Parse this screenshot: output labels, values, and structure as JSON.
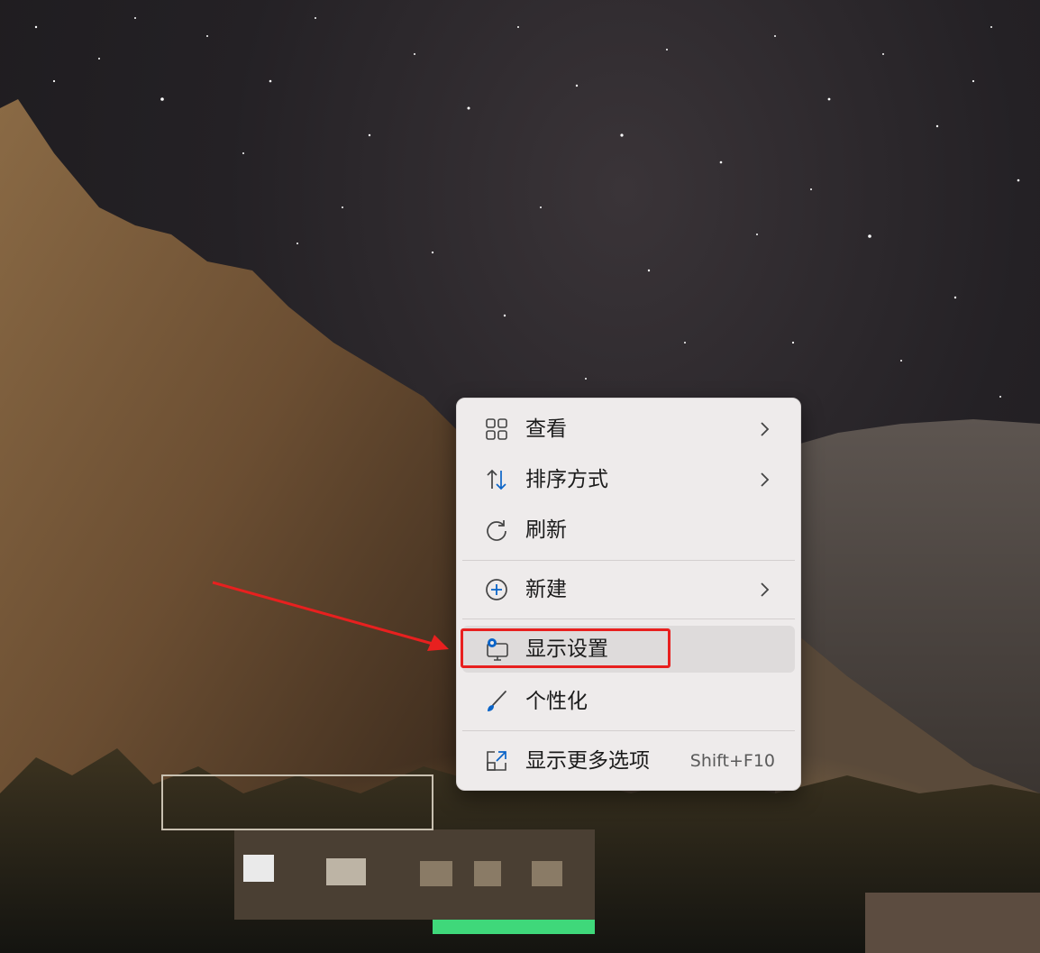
{
  "context_menu": {
    "items": [
      {
        "label": "查看",
        "icon": "grid-view-icon",
        "has_submenu": true
      },
      {
        "label": "排序方式",
        "icon": "sort-arrows-icon",
        "has_submenu": true
      },
      {
        "label": "刷新",
        "icon": "refresh-icon",
        "has_submenu": false
      },
      {
        "label": "新建",
        "icon": "add-circle-icon",
        "has_submenu": true
      },
      {
        "label": "显示设置",
        "icon": "display-settings-icon",
        "has_submenu": false,
        "highlighted": true
      },
      {
        "label": "个性化",
        "icon": "brush-icon",
        "has_submenu": false
      },
      {
        "label": "显示更多选项",
        "icon": "open-external-icon",
        "shortcut": "Shift+F10"
      }
    ]
  },
  "annotation": {
    "color": "#e8201f",
    "target": "显示设置"
  },
  "colors": {
    "menu_background": "#eeebeb",
    "hover_background": "#dedbdb",
    "accent_blue": "#0a64c8"
  }
}
